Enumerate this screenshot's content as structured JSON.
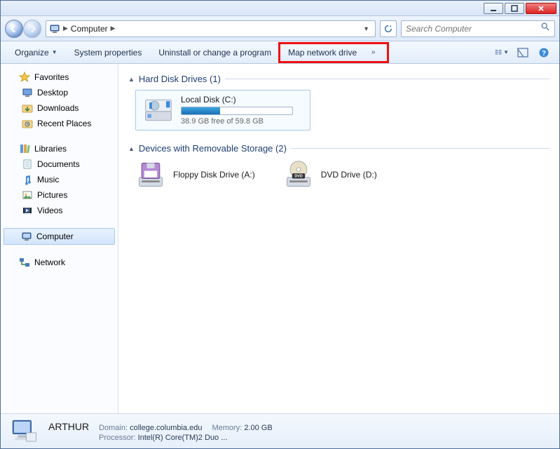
{
  "window": {
    "min": "_",
    "max": "□",
    "close": "✕"
  },
  "nav": {
    "crumb_root": "Computer",
    "search_placeholder": "Search Computer"
  },
  "toolbar": {
    "organize": "Organize",
    "sysprops": "System properties",
    "uninstall": "Uninstall or change a program",
    "mapdrive": "Map network drive"
  },
  "sidebar": {
    "favorites": {
      "label": "Favorites",
      "items": [
        "Desktop",
        "Downloads",
        "Recent Places"
      ]
    },
    "libraries": {
      "label": "Libraries",
      "items": [
        "Documents",
        "Music",
        "Pictures",
        "Videos"
      ]
    },
    "computer": {
      "label": "Computer"
    },
    "network": {
      "label": "Network"
    }
  },
  "groups": {
    "hdd": {
      "title": "Hard Disk Drives (1)"
    },
    "rem": {
      "title": "Devices with Removable Storage (2)"
    }
  },
  "drives": {
    "c": {
      "name": "Local Disk (C:)",
      "free_text": "38.9 GB free of 59.8 GB",
      "used_pct": 35
    },
    "a": {
      "name": "Floppy Disk Drive (A:)"
    },
    "d": {
      "name": "DVD Drive (D:)"
    }
  },
  "status": {
    "computer_name": "ARTHUR",
    "domain_label": "Domain:",
    "domain": "college.columbia.edu",
    "memory_label": "Memory:",
    "memory": "2.00 GB",
    "processor_label": "Processor:",
    "processor": "Intel(R) Core(TM)2 Duo ..."
  }
}
